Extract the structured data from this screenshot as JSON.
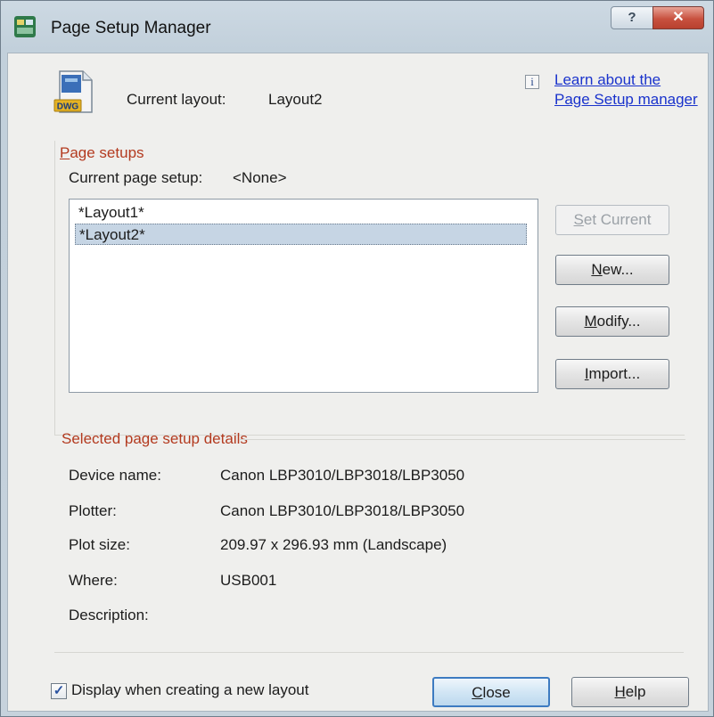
{
  "window": {
    "title": "Page Setup Manager",
    "help_button": "?",
    "close_button": "✕"
  },
  "header": {
    "dwg_icon_label": "DWG",
    "current_layout_label": "Current layout:",
    "current_layout_value": "Layout2",
    "learn_link_line1": "Learn about the",
    "learn_link_line2": "Page Setup manager",
    "info_icon": "i"
  },
  "page_setups": {
    "section_title_mnemonic": "P",
    "section_title_rest": "age setups",
    "current_label": "Current page setup:",
    "current_value": "<None>",
    "items": [
      {
        "label": "*Layout1*",
        "selected": false
      },
      {
        "label": "*Layout2*",
        "selected": true
      }
    ],
    "buttons": {
      "set_current": {
        "mnemonic": "S",
        "rest": "et Current",
        "enabled": false
      },
      "new": {
        "mnemonic": "N",
        "rest": "ew...",
        "enabled": true
      },
      "modify": {
        "mnemonic": "M",
        "rest": "odify...",
        "enabled": true
      },
      "import": {
        "mnemonic": "I",
        "rest": "mport...",
        "enabled": true
      }
    }
  },
  "details": {
    "title": "Selected page setup details",
    "rows": [
      {
        "label": "Device name:",
        "value": "Canon LBP3010/LBP3018/LBP3050"
      },
      {
        "label": "Plotter:",
        "value": "Canon LBP3010/LBP3018/LBP3050"
      },
      {
        "label": "Plot size:",
        "value": "209.97 x 296.93 mm (Landscape)"
      },
      {
        "label": "Where:",
        "value": "USB001"
      },
      {
        "label": "Description:",
        "value": ""
      }
    ]
  },
  "footer": {
    "checkbox_checked": true,
    "checkbox_label": "Display when creating a new layout",
    "close_mnemonic": "C",
    "close_rest": "lose",
    "help_mnemonic": "H",
    "help_rest": "elp"
  },
  "colors": {
    "section_title": "#b33a1f",
    "link": "#1a33cc",
    "selection": "#c6d5e4"
  }
}
